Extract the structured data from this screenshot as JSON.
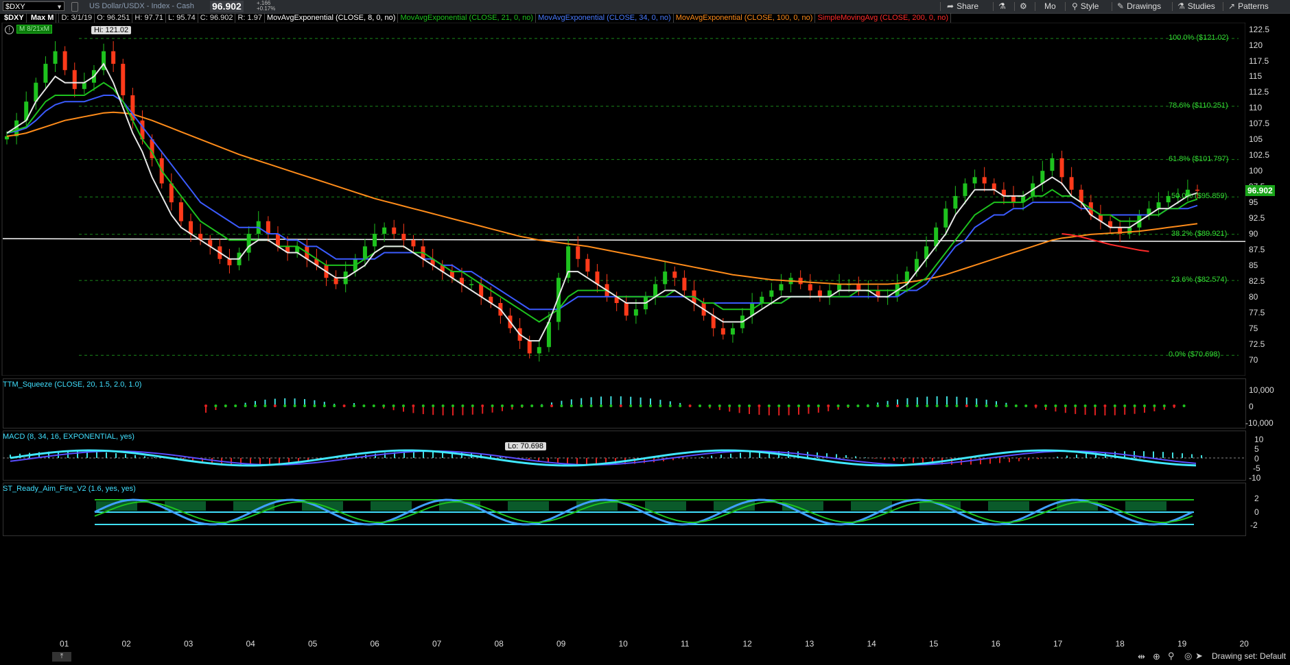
{
  "toolbar": {
    "symbol": "$DXY",
    "description": "US Dollar/USDX - Index - Cash",
    "last": "96.902",
    "change_abs": "+.166",
    "change_pct": "+0.17%",
    "share": "Share",
    "aggregation": "Mo",
    "style": "Style",
    "drawings": "Drawings",
    "studies": "Studies",
    "patterns": "Patterns"
  },
  "infobar": {
    "symbol": "$DXY",
    "period": "Max M",
    "date": "D: 3/1/19",
    "open": "O: 96.251",
    "high": "H: 97.71",
    "low": "L: 95.74",
    "close": "C: 96.902",
    "range": "R: 1.97",
    "studies": [
      {
        "label": "MovAvgExponential (CLOSE, 8, 0, no)",
        "color": "#ffffff"
      },
      {
        "label": "MovAvgExponential (CLOSE, 21, 0, no)",
        "color": "#1ec21e"
      },
      {
        "label": "MovAvgExponential (CLOSE, 34, 0, no)",
        "color": "#3b5bff"
      },
      {
        "label": "MovAvgExponential (CLOSE, 100, 0, no)",
        "color": "#ff8c1a"
      },
      {
        "label": "SimpleMovingAvg (CLOSE, 200, 0, no)",
        "color": "#ff2a2a"
      }
    ],
    "badge": "8/21xM"
  },
  "chart_data": {
    "type": "candlestick",
    "title": "$DXY",
    "ylim": [
      68,
      123
    ],
    "yticks": [
      "122.5",
      "120",
      "117.5",
      "115",
      "112.5",
      "110",
      "107.5",
      "105",
      "102.5",
      "100",
      "97.5",
      "95",
      "92.5",
      "90",
      "87.5",
      "85",
      "82.5",
      "80",
      "77.5",
      "75",
      "72.5",
      "70"
    ],
    "xticks": [
      "01",
      "02",
      "03",
      "04",
      "05",
      "06",
      "07",
      "08",
      "09",
      "10",
      "11",
      "12",
      "13",
      "14",
      "15",
      "16",
      "17",
      "18",
      "19",
      "20"
    ],
    "hi_label": "Hi: 121.02",
    "lo_label": "Lo: 70.698",
    "current_price": "96.902",
    "fib_levels": [
      {
        "label": "100.0% ($121.02)",
        "value": 121.02
      },
      {
        "label": "78.6% ($110.251)",
        "value": 110.251
      },
      {
        "label": "61.8% ($101.797)",
        "value": 101.797
      },
      {
        "label": "50.0% ($95.859)",
        "value": 95.859
      },
      {
        "label": "38.2% ($89.921)",
        "value": 89.921
      },
      {
        "label": "23.6% ($82.574)",
        "value": 82.574
      },
      {
        "label": "0.0% ($70.698)",
        "value": 70.698
      }
    ],
    "horizontal_line": 89.0,
    "closes": [
      105.5,
      108,
      111,
      114,
      117,
      119,
      116,
      113,
      114,
      116,
      119,
      117,
      112,
      108,
      105,
      102,
      98,
      95,
      92,
      90,
      89,
      88,
      86,
      85,
      87,
      90,
      92,
      90,
      88,
      87,
      88,
      86,
      85,
      83,
      82,
      84,
      86,
      88,
      90,
      91,
      90,
      89,
      88,
      86,
      85,
      84,
      83,
      82,
      82,
      80,
      79,
      77,
      75,
      73,
      71,
      72,
      76,
      83,
      88,
      86,
      84,
      82,
      80,
      79,
      77,
      78,
      80,
      82,
      84,
      83,
      81,
      79,
      77,
      75,
      74,
      75,
      77,
      79,
      80,
      81,
      82,
      83,
      82,
      81,
      80,
      81,
      82,
      82,
      81,
      81,
      80,
      80,
      82,
      84,
      86,
      88,
      91,
      94,
      96,
      98,
      99,
      98,
      97,
      96,
      95,
      96,
      98,
      100,
      102,
      99,
      97,
      95,
      93,
      92,
      91,
      90,
      91,
      93,
      94,
      95,
      96,
      96,
      97,
      96.9
    ],
    "ema8": [
      106,
      107,
      108,
      111,
      113,
      115,
      114,
      114,
      114,
      115,
      117,
      114,
      110,
      106,
      103,
      99,
      96,
      93,
      91,
      90,
      89,
      88,
      87,
      86,
      86,
      88,
      89,
      89,
      88,
      87,
      87,
      86,
      85,
      84,
      83,
      83,
      84,
      85,
      87,
      88,
      88,
      88,
      87,
      86,
      85,
      84,
      83,
      82,
      81,
      80,
      79,
      78,
      76,
      74,
      73,
      73,
      76,
      80,
      84,
      84,
      83,
      82,
      81,
      80,
      79,
      79,
      79,
      80,
      81,
      81,
      80,
      79,
      78,
      77,
      76,
      76,
      76,
      77,
      78,
      79,
      80,
      80,
      80,
      80,
      80,
      80,
      81,
      81,
      81,
      81,
      80,
      80,
      81,
      82,
      84,
      86,
      88,
      90,
      93,
      95,
      97,
      97,
      97,
      96,
      96,
      96,
      97,
      98,
      99,
      98,
      96,
      95,
      93,
      92,
      91,
      91,
      91,
      92,
      93,
      94,
      94,
      95,
      96,
      96.5
    ],
    "ema21": [
      106,
      106.5,
      107,
      109,
      111,
      112,
      112,
      112,
      112,
      113,
      114,
      113,
      111,
      108,
      105,
      103,
      100,
      98,
      96,
      94,
      92,
      91,
      90,
      89,
      89,
      89,
      89,
      89,
      88,
      88,
      88,
      87,
      86,
      85,
      85,
      85,
      85,
      86,
      87,
      88,
      88,
      88,
      87,
      87,
      86,
      85,
      84,
      84,
      83,
      82,
      81,
      80,
      79,
      78,
      77,
      76,
      77,
      78,
      80,
      81,
      81,
      81,
      81,
      80,
      80,
      80,
      80,
      80,
      80,
      81,
      80,
      80,
      79,
      79,
      78,
      78,
      78,
      78,
      79,
      79,
      79,
      80,
      80,
      80,
      80,
      80,
      80,
      80,
      81,
      81,
      81,
      81,
      81,
      81,
      82,
      83,
      85,
      87,
      89,
      91,
      93,
      94,
      95,
      95,
      95,
      95,
      96,
      96,
      97,
      96,
      96,
      95,
      94,
      93,
      93,
      92,
      92,
      92,
      93,
      93,
      94,
      94,
      95,
      95.5
    ],
    "ema34": [
      106,
      106.3,
      106.8,
      108,
      109.5,
      110.5,
      111,
      111,
      111,
      111.5,
      112,
      112,
      111,
      109,
      107,
      105,
      103,
      101,
      99,
      97,
      95,
      94,
      93,
      92,
      91,
      91,
      91,
      90,
      90,
      89,
      89,
      88,
      88,
      87,
      86,
      86,
      86,
      86,
      86,
      87,
      87,
      87,
      87,
      86,
      86,
      85,
      85,
      84,
      84,
      83,
      82,
      81,
      80,
      79,
      78,
      78,
      78,
      78,
      79,
      80,
      80,
      80,
      80,
      80,
      80,
      80,
      80,
      80,
      80,
      80,
      80,
      80,
      79,
      79,
      79,
      79,
      79,
      79,
      79,
      79,
      79,
      80,
      80,
      80,
      80,
      80,
      80,
      80,
      80,
      80,
      80,
      80,
      80,
      81,
      81,
      82,
      84,
      86,
      88,
      89,
      91,
      92,
      93,
      93,
      94,
      94,
      95,
      95,
      95,
      95,
      95,
      94,
      94,
      93,
      93,
      93,
      93,
      93,
      93,
      93,
      94,
      94,
      94,
      94.5
    ],
    "ema100": [
      105.5,
      105.7,
      106,
      106.5,
      107,
      107.5,
      108,
      108.3,
      108.6,
      108.9,
      109.2,
      109.3,
      109.2,
      109,
      108.5,
      108,
      107.4,
      106.8,
      106.2,
      105.6,
      105,
      104.4,
      103.8,
      103.2,
      102.6,
      102.1,
      101.6,
      101.1,
      100.6,
      100.1,
      99.6,
      99.1,
      98.6,
      98.1,
      97.6,
      97.1,
      96.6,
      96.1,
      95.6,
      95.2,
      94.8,
      94.4,
      94,
      93.6,
      93.2,
      92.8,
      92.4,
      92,
      91.6,
      91.2,
      90.8,
      90.4,
      90,
      89.6,
      89.3,
      89,
      88.8,
      88.6,
      88.4,
      88.2,
      88,
      87.7,
      87.4,
      87.1,
      86.8,
      86.5,
      86.2,
      85.9,
      85.6,
      85.3,
      85,
      84.7,
      84.4,
      84.1,
      83.8,
      83.5,
      83.3,
      83.1,
      82.9,
      82.7,
      82.6,
      82.5,
      82.4,
      82.3,
      82.2,
      82.1,
      82,
      82,
      82,
      82,
      82,
      82,
      82.1,
      82.3,
      82.5,
      82.8,
      83.1,
      83.5,
      84,
      84.5,
      85,
      85.5,
      86,
      86.5,
      87,
      87.5,
      88,
      88.5,
      89,
      89.3,
      89.5,
      89.7,
      89.9,
      90,
      90.1,
      90.2,
      90.3,
      90.4,
      90.6,
      90.8,
      91,
      91.2,
      91.4,
      91.6
    ],
    "sma200_tail": [
      90.0,
      89.8,
      89.5,
      89.1,
      88.7,
      88.3,
      88.0,
      87.7,
      87.4,
      87.2
    ],
    "squeeze": {
      "title": "TTM_Squeeze (CLOSE, 20, 1.5, 2.0, 1.0)",
      "yticks": [
        "10,000",
        "0",
        "-10,000"
      ]
    },
    "macd": {
      "title": "MACD (8, 34, 16, EXPONENTIAL, yes)",
      "yticks": [
        "10",
        "5",
        "0",
        "-5",
        "-10"
      ]
    },
    "raf": {
      "title": "ST_Ready_Aim_Fire_V2 (1.6, yes, yes)",
      "yticks": [
        "2",
        "0",
        "-2"
      ]
    }
  },
  "bottom": {
    "drawing_set": "Drawing set: Default"
  }
}
